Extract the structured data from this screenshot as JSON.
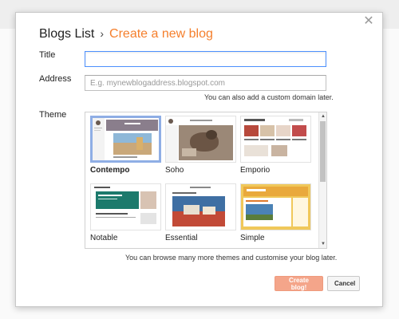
{
  "header": {
    "breadcrumb_root": "Blogs List",
    "separator": "›",
    "current": "Create a new blog"
  },
  "close_icon": "close-icon",
  "form": {
    "title_label": "Title",
    "title_value": "",
    "address_label": "Address",
    "address_placeholder": "E.g. mynewblogaddress.blogspot.com",
    "address_hint": "You can also add a custom domain later.",
    "theme_label": "Theme",
    "themes": [
      {
        "name": "Contempo",
        "selected": true
      },
      {
        "name": "Soho",
        "selected": false
      },
      {
        "name": "Emporio",
        "selected": false
      },
      {
        "name": "Notable",
        "selected": false
      },
      {
        "name": "Essential",
        "selected": false
      },
      {
        "name": "Simple",
        "selected": false
      }
    ],
    "theme_hint": "You can browse many more themes and customise your blog later."
  },
  "buttons": {
    "create": "Create blog!",
    "cancel": "Cancel"
  },
  "colors": {
    "accent": "#f57f2c",
    "primary_button": "#f4a58a",
    "focus_border": "#4d90fe",
    "selected_theme_border": "#8faee5"
  }
}
